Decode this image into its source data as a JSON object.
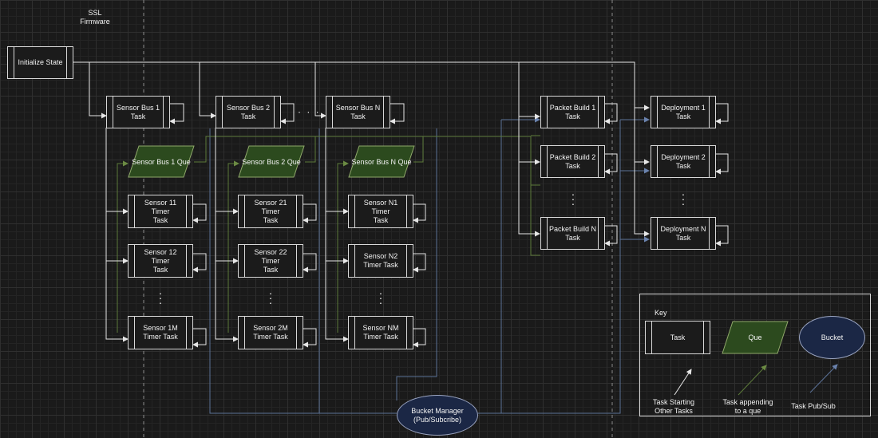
{
  "header": {
    "title": "SSL\nFirmware"
  },
  "init": {
    "label": "Initialize State"
  },
  "sensor_bus": [
    {
      "label": "Sensor Bus 1\nTask"
    },
    {
      "label": "Sensor Bus 2\nTask"
    },
    {
      "label": "Sensor Bus N\nTask"
    }
  ],
  "ques": [
    {
      "label": "Sensor Bus 1 Que"
    },
    {
      "label": "Sensor Bus 2 Que"
    },
    {
      "label": "Sensor Bus N Que"
    }
  ],
  "timers": [
    [
      {
        "label": "Sensor 11 Timer\nTask"
      },
      {
        "label": "Sensor 12 Timer\nTask"
      },
      {
        "label": "Sensor  1M\nTimer Task"
      }
    ],
    [
      {
        "label": "Sensor 21 Timer\nTask"
      },
      {
        "label": "Sensor 22 Timer\nTask"
      },
      {
        "label": "Sensor  2M\nTimer Task"
      }
    ],
    [
      {
        "label": "Sensor N1 Timer\nTask"
      },
      {
        "label": "Sensor N2\nTimer  Task"
      },
      {
        "label": "Sensor  NM\nTimer Task"
      }
    ]
  ],
  "packet_build": [
    {
      "label": "Packet Build 1\nTask"
    },
    {
      "label": "Packet Build 2\nTask"
    },
    {
      "label": "Packet Build N\nTask"
    }
  ],
  "deployment": [
    {
      "label": "Deployment 1\nTask"
    },
    {
      "label": "Deployment 2\nTask"
    },
    {
      "label": "Deployment N\nTask"
    }
  ],
  "bucket_manager": {
    "label": "Bucket Manager\n(Pub/Subcribe)"
  },
  "ellipsis": {
    "vertical": "·\n·\n·",
    "horizontal": "· · ·"
  },
  "key": {
    "title": "Key",
    "task": "Task",
    "que": "Que",
    "bucket": "Bucket",
    "task_start": "Task Starting\nOther Tasks",
    "que_append": "Task appending\nto a que",
    "pubsub": "Task Pub/Sub"
  },
  "colors": {
    "background": "#1a1a1a",
    "white_line": "#e6e6e6",
    "green_line": "#5c7a3a",
    "blue_line": "#5b7196",
    "que_fill": "#2c4a1e",
    "bucket_fill": "#1b2745"
  }
}
